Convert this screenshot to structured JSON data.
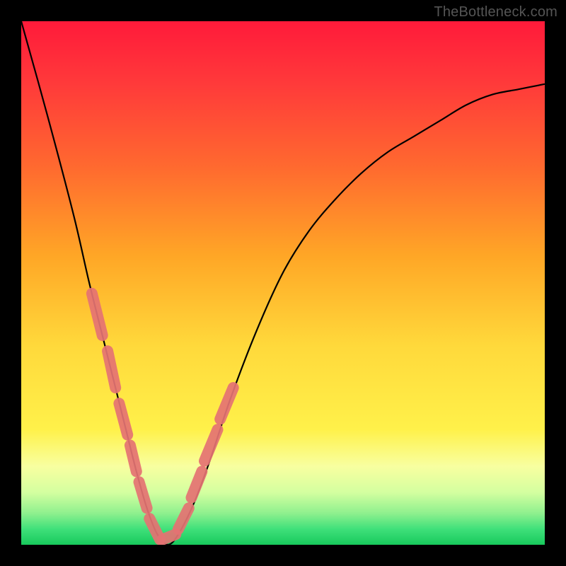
{
  "watermark": "TheBottleneck.com",
  "chart_data": {
    "type": "line",
    "title": "",
    "xlabel": "",
    "ylabel": "",
    "xlim": [
      0,
      100
    ],
    "ylim": [
      0,
      100
    ],
    "grid": false,
    "legend": false,
    "series": [
      {
        "name": "bottleneck-curve",
        "x": [
          0,
          5,
          10,
          13,
          16,
          18,
          20,
          22,
          24,
          26,
          28,
          30,
          33,
          36,
          40,
          45,
          50,
          55,
          60,
          65,
          70,
          75,
          80,
          85,
          90,
          95,
          100
        ],
        "values": [
          100,
          82,
          63,
          50,
          38,
          30,
          22,
          14,
          7,
          2,
          0,
          2,
          8,
          16,
          28,
          41,
          52,
          60,
          66,
          71,
          75,
          78,
          81,
          84,
          86,
          87,
          88
        ]
      }
    ],
    "overlay_segments": {
      "name": "highlighted-points",
      "color": "#e57373",
      "segments": [
        {
          "x": [
            13.5,
            15.5
          ],
          "y": [
            48,
            40
          ]
        },
        {
          "x": [
            16.5,
            18.0
          ],
          "y": [
            37,
            30
          ]
        },
        {
          "x": [
            18.7,
            20.3
          ],
          "y": [
            27,
            21
          ]
        },
        {
          "x": [
            20.8,
            22.0
          ],
          "y": [
            19,
            14
          ]
        },
        {
          "x": [
            22.5,
            24.0
          ],
          "y": [
            12,
            7
          ]
        },
        {
          "x": [
            24.5,
            26.5
          ],
          "y": [
            5,
            1
          ]
        },
        {
          "x": [
            27.0,
            29.5
          ],
          "y": [
            1,
            2
          ]
        },
        {
          "x": [
            30.0,
            32.0
          ],
          "y": [
            3,
            7
          ]
        },
        {
          "x": [
            32.5,
            34.5
          ],
          "y": [
            9,
            14
          ]
        },
        {
          "x": [
            35.0,
            37.5
          ],
          "y": [
            16,
            22
          ]
        },
        {
          "x": [
            38.0,
            40.5
          ],
          "y": [
            24,
            30
          ]
        }
      ]
    },
    "background_gradient": {
      "stops": [
        {
          "pos": 0.0,
          "color": "#ff1a3a"
        },
        {
          "pos": 0.12,
          "color": "#ff3a3a"
        },
        {
          "pos": 0.28,
          "color": "#ff6a2f"
        },
        {
          "pos": 0.45,
          "color": "#ffa726"
        },
        {
          "pos": 0.62,
          "color": "#ffd93b"
        },
        {
          "pos": 0.78,
          "color": "#fff14a"
        },
        {
          "pos": 0.85,
          "color": "#f8ffa0"
        },
        {
          "pos": 0.9,
          "color": "#d4ffa0"
        },
        {
          "pos": 0.94,
          "color": "#8ef08e"
        },
        {
          "pos": 0.97,
          "color": "#3fe07a"
        },
        {
          "pos": 1.0,
          "color": "#18c95c"
        }
      ]
    }
  }
}
